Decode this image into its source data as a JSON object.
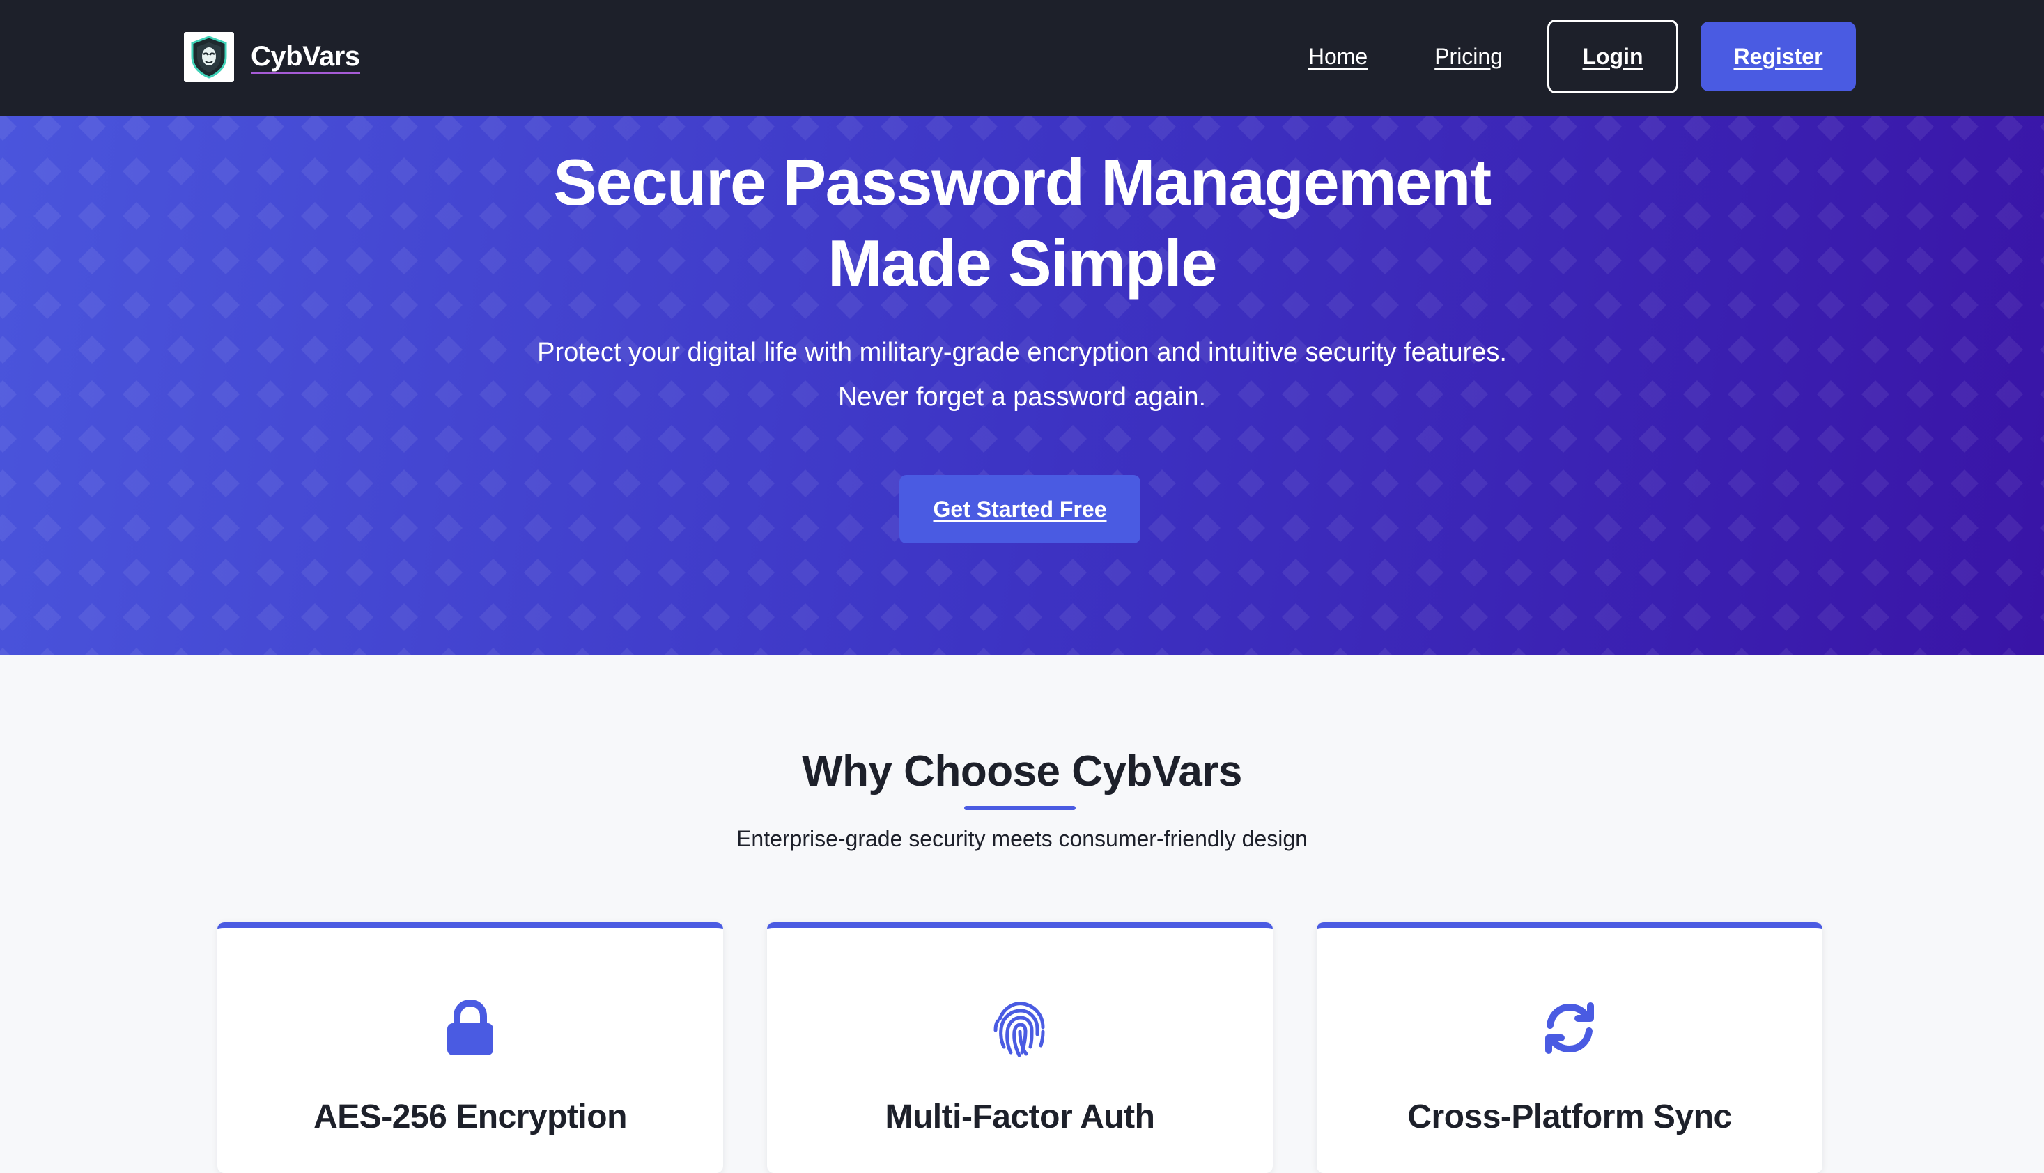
{
  "navbar": {
    "brand_name": "CybVars",
    "links": [
      {
        "label": "Home"
      },
      {
        "label": "Pricing"
      }
    ],
    "login_label": "Login",
    "register_label": "Register"
  },
  "hero": {
    "title_line1": "Secure Password Management",
    "title_line2": "Made Simple",
    "subtitle_line1": "Protect your digital life with military-grade encryption and intuitive security features.",
    "subtitle_line2": "Never forget a password again.",
    "cta_label": "Get Started Free"
  },
  "features": {
    "title": "Why Choose CybVars",
    "subtitle": "Enterprise-grade security meets consumer-friendly design",
    "cards": [
      {
        "icon": "lock-icon",
        "title": "AES-256 Encryption"
      },
      {
        "icon": "fingerprint-icon",
        "title": "Multi-Factor Auth"
      },
      {
        "icon": "sync-icon",
        "title": "Cross-Platform Sync"
      }
    ]
  },
  "colors": {
    "navbar_bg": "#1d202a",
    "accent": "#4a5be2",
    "hero_gradient_start": "#4a55dc",
    "hero_gradient_end": "#3914a6",
    "page_bg": "#f7f8fa"
  }
}
